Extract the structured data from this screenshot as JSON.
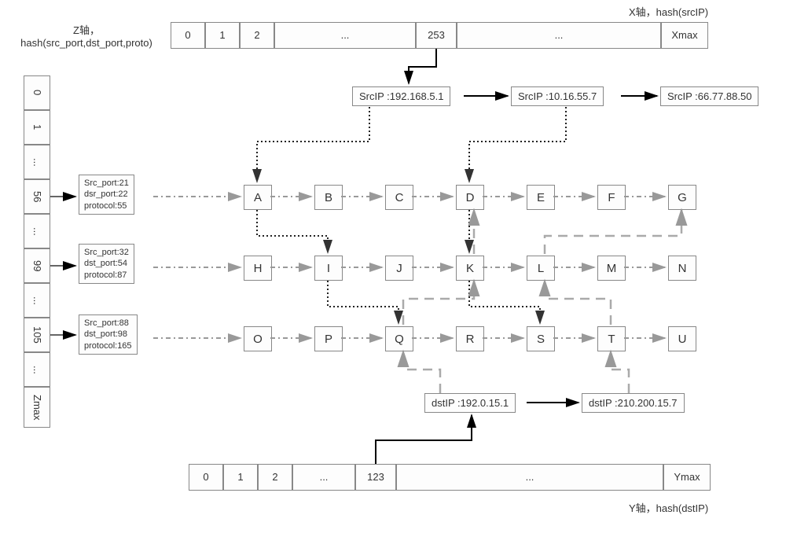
{
  "axes": {
    "x": {
      "label": "X轴，hash(srcIP)",
      "cells": [
        "0",
        "1",
        "2",
        "...",
        "253",
        "...",
        "Xmax"
      ]
    },
    "y": {
      "label": "Y轴，hash(dstIP)",
      "cells": [
        "0",
        "1",
        "2",
        "...",
        "123",
        "...",
        "Ymax"
      ]
    },
    "z": {
      "label": "Z轴，\nhash(src_port,dst_port,proto)",
      "cells": [
        "0",
        "1",
        "...",
        "56",
        "...",
        "99",
        "...",
        "105",
        "...",
        "Zmax"
      ]
    }
  },
  "srcips": [
    "SrcIP :192.168.5.1",
    "SrcIP :10.16.55.7",
    "SrcIP :66.77.88.50"
  ],
  "dstips": [
    "dstIP :192.0.15.1",
    "dstIP :210.200.15.7"
  ],
  "protos": [
    {
      "l1": "Src_port:21",
      "l2": "dsr_port:22",
      "l3": "protocol:55"
    },
    {
      "l1": "Src_port:32",
      "l2": "dst_port:54",
      "l3": "protocol:87"
    },
    {
      "l1": "Src_port:88",
      "l2": "dst_port:98",
      "l3": "protocol:165"
    }
  ],
  "rows": [
    [
      "A",
      "B",
      "C",
      "D",
      "E",
      "F",
      "G"
    ],
    [
      "H",
      "I",
      "J",
      "K",
      "L",
      "M",
      "N"
    ],
    [
      "O",
      "P",
      "Q",
      "R",
      "S",
      "T",
      "U"
    ]
  ]
}
